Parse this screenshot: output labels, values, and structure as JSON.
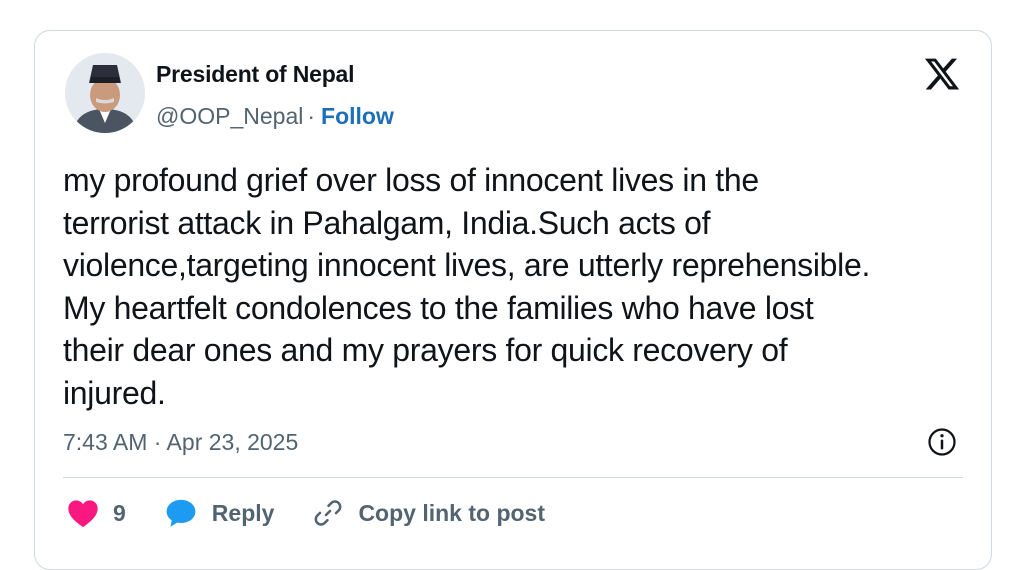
{
  "author": {
    "display_name": "President of Nepal",
    "handle": "@OOP_Nepal",
    "separator": "·",
    "follow_label": "Follow"
  },
  "post": {
    "text": "my profound grief over loss of innocent lives in the\nterrorist attack in Pahalgam, India.Such acts of\nviolence,targeting innocent lives, are utterly reprehensible.\nMy heartfelt condolences to the families who have lost\ntheir dear ones and my prayers for quick recovery of\ninjured.",
    "timestamp": "7:43 AM · Apr 23, 2025"
  },
  "actions": {
    "like_count": "9",
    "reply_label": "Reply",
    "copy_link_label": "Copy link to post"
  },
  "icons": {
    "logo": "x-logo-icon",
    "info": "info-icon",
    "like": "heart-icon",
    "reply": "speech-bubble-icon",
    "link": "link-icon"
  },
  "colors": {
    "heart": "#f91880",
    "reply_bubble": "#1d9bf0",
    "follow": "#1d6fb8",
    "secondary_text": "#536471",
    "border": "#cfd9de"
  }
}
